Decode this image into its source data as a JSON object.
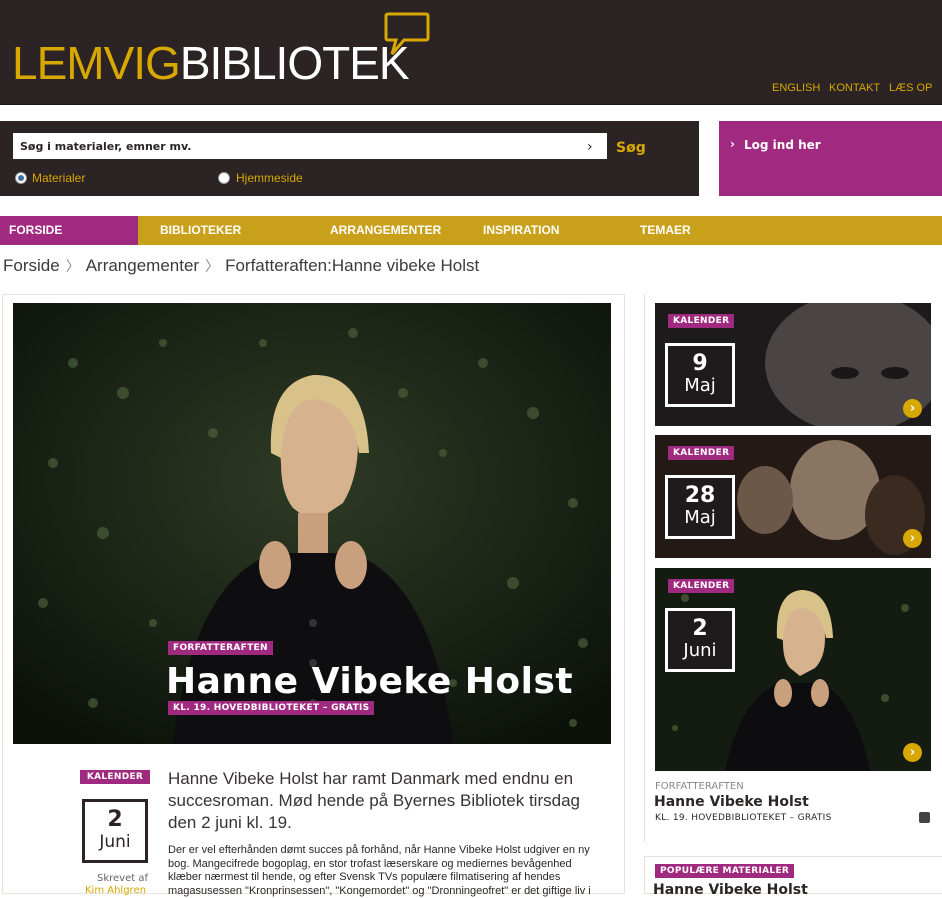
{
  "header": {
    "logo_part1": "LEMVIG",
    "logo_part2": "BIBLIOTEK",
    "links": [
      "ENGLISH",
      "KONTAKT",
      "LÆS OP"
    ]
  },
  "search": {
    "placeholder": "Søg i materialer, emner mv.",
    "button": "Søg",
    "options": [
      "Materialer",
      "Hjemmeside"
    ],
    "selected": "Materialer"
  },
  "login": {
    "label": "Log ind her"
  },
  "nav": {
    "items": [
      "FORSIDE",
      "BIBLIOTEKER",
      "ARRANGEMENTER",
      "INSPIRATION",
      "TEMAER"
    ],
    "active": "FORSIDE"
  },
  "breadcrumb": [
    "Forside",
    "Arrangementer",
    "Forfatteraften:Hanne vibeke Holst"
  ],
  "hero": {
    "category": "FORFATTERAFTEN",
    "title": "Hanne Vibeke Holst",
    "subtitle": "KL. 19. HOVEDBIBLIOTEKET – GRATIS"
  },
  "article": {
    "tag": "KALENDER",
    "date_day": "2",
    "date_month": "Juni",
    "written_by_label": "Skrevet af",
    "author": "Kim Ahlgren",
    "lead": "Hanne Vibeke Holst har ramt Danmark med endnu en succesroman. Mød hende på Byernes Bibliotek tirsdag den 2 juni kl. 19.",
    "body": "Der er vel efterhånden dømt succes på forhånd, når Hanne Vibeke Holst udgiver en ny bog. Mangecifrede bogoplag, en stor trofast læserskare og mediernes bevågenhed klæber nærmest til hende, og efter Svensk TVs populære filmatisering af hendes magasusessen \"Kronprinsessen\", \"Kongemordet\" og \"Dronningeofret\" er det giftige liv i"
  },
  "sidebar": {
    "cards": [
      {
        "tag": "KALENDER",
        "day": "9",
        "month": "Maj"
      },
      {
        "tag": "KALENDER",
        "day": "28",
        "month": "Maj"
      },
      {
        "tag": "KALENDER",
        "day": "2",
        "month": "Juni"
      }
    ],
    "featured": {
      "category": "FORFATTERAFTEN",
      "title": "Hanne Vibeke Holst",
      "subtitle": "KL. 19. HOVEDBIBLIOTEKET – GRATIS"
    },
    "popular_tag": "POPULÆRE MATERIALER",
    "popular_title": "Hanne Vibeke Holst"
  },
  "colors": {
    "brand_gold": "#d6a800",
    "brand_magenta": "#a02a80",
    "header_dark": "#2b2324"
  }
}
